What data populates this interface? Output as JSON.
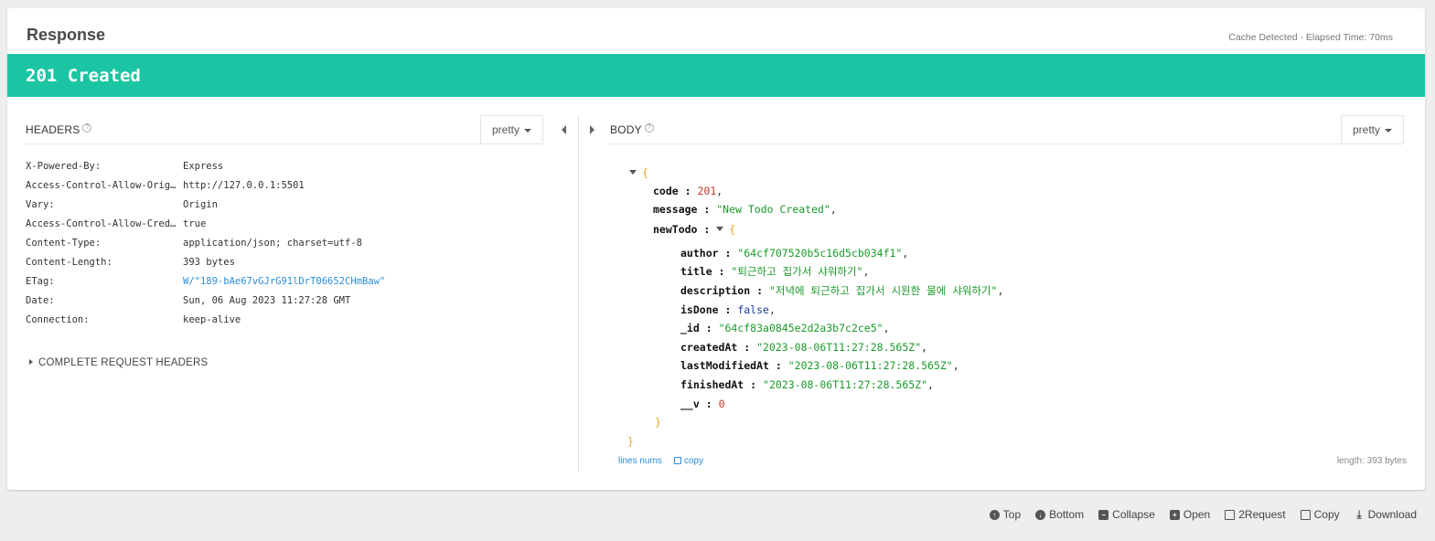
{
  "header": {
    "title": "Response",
    "cache_info": "Cache Detected - Elapsed Time: 70ms"
  },
  "status": {
    "text": "201 Created",
    "color": "#1bc5a3"
  },
  "headers_pane": {
    "label": "HEADERS",
    "view_mode": "pretty",
    "rows": [
      {
        "key": "X-Powered-By:",
        "value": "Express"
      },
      {
        "key": "Access-Control-Allow-Origin:",
        "value": "http://127.0.0.1:5501"
      },
      {
        "key": "Vary:",
        "value": "Origin"
      },
      {
        "key": "Access-Control-Allow-Crede…",
        "value": "true"
      },
      {
        "key": "Content-Type:",
        "value": "application/json; charset=utf-8"
      },
      {
        "key": "Content-Length:",
        "value": "393 bytes"
      },
      {
        "key": "ETag:",
        "value": "W/\"189-bAe67vGJrG91lDrT06652CHmBaw\""
      },
      {
        "key": "Date:",
        "value": "Sun, 06 Aug 2023 11:27:28 GMT"
      },
      {
        "key": "Connection:",
        "value": "keep-alive"
      }
    ],
    "complete_request_label": "COMPLETE REQUEST HEADERS"
  },
  "body_pane": {
    "label": "BODY",
    "view_mode": "pretty",
    "json": {
      "code_key": "code :",
      "code_val": "201",
      "message_key": "message :",
      "message_val": "\"New Todo Created\"",
      "newTodo_key": "newTodo :",
      "author_key": "author :",
      "author_val": "\"64cf707520b5c16d5cb034f1\"",
      "title_key": "title :",
      "title_val": "\"퇴근하고 집가서 샤워하기\"",
      "description_key": "description :",
      "description_val": "\"저녁에 퇴근하고 집가서 시원한 물에 샤워하기\"",
      "isDone_key": "isDone :",
      "isDone_val": "false",
      "id_key": "_id :",
      "id_val": "\"64cf83a0845e2d2a3b7c2ce5\"",
      "createdAt_key": "createdAt :",
      "createdAt_val": "\"2023-08-06T11:27:28.565Z\"",
      "lastModifiedAt_key": "lastModifiedAt :",
      "lastModifiedAt_val": "\"2023-08-06T11:27:28.565Z\"",
      "finishedAt_key": "finishedAt :",
      "finishedAt_val": "\"2023-08-06T11:27:28.565Z\"",
      "v_key": "__v :",
      "v_val": "0"
    },
    "lines_nums_label": "lines nums",
    "copy_label": "copy",
    "length_info": "length: 393 bytes"
  },
  "toolbar": {
    "top": "Top",
    "bottom": "Bottom",
    "collapse": "Collapse",
    "open": "Open",
    "to_request": "2Request",
    "copy": "Copy",
    "download": "Download"
  }
}
